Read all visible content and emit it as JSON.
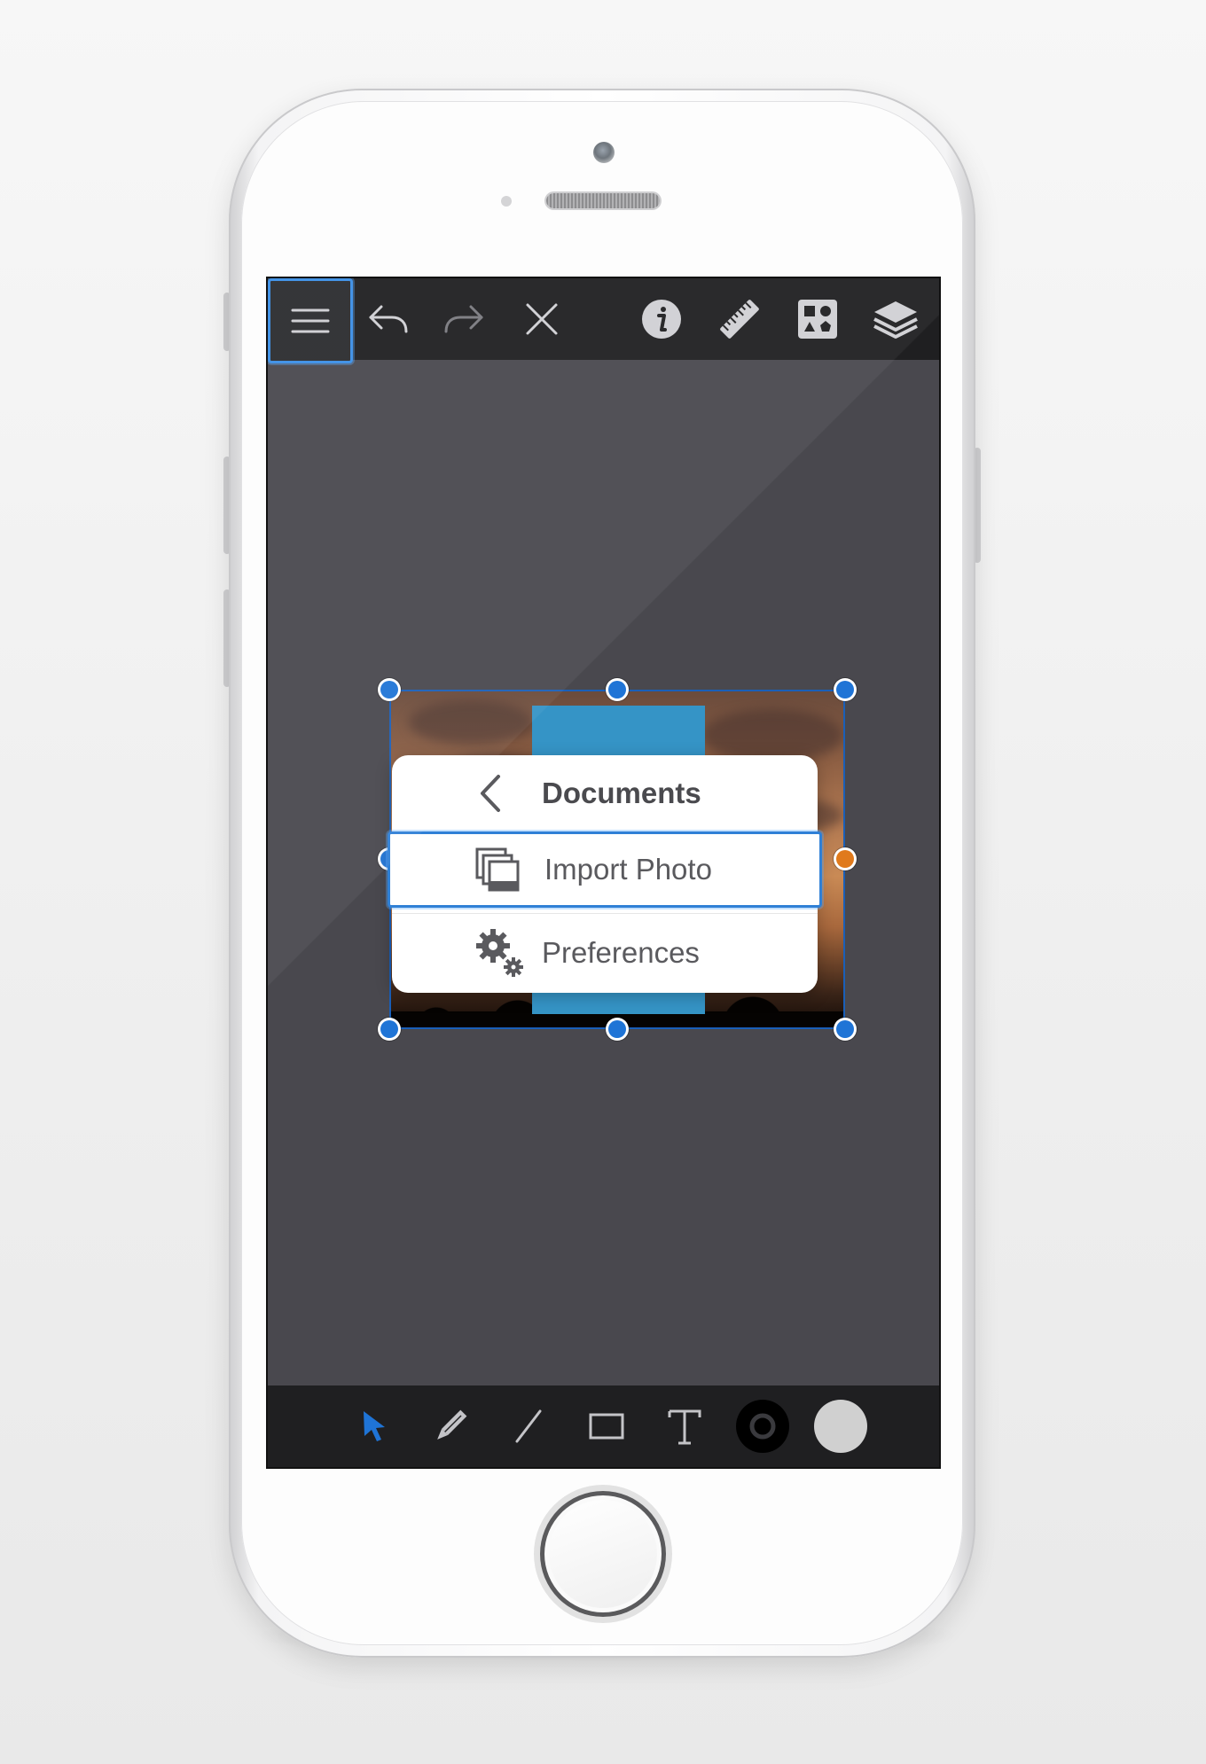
{
  "toolbar": {
    "buttons": [
      {
        "name": "menu-icon",
        "selected": true
      },
      {
        "name": "undo-icon"
      },
      {
        "name": "redo-icon",
        "disabled": true
      },
      {
        "name": "close-icon"
      },
      {
        "name": "info-icon"
      },
      {
        "name": "ruler-icon"
      },
      {
        "name": "shapes-icon"
      },
      {
        "name": "layers-icon"
      }
    ]
  },
  "popup_menu": {
    "header_label": "Documents",
    "items": [
      {
        "label": "Import Photo",
        "icon": "photos-icon",
        "selected": true
      },
      {
        "label": "Preferences",
        "icon": "gears-icon",
        "selected": false
      }
    ]
  },
  "bottom_toolbar": {
    "tools": [
      {
        "name": "select-arrow-icon",
        "active": true
      },
      {
        "name": "pencil-icon"
      },
      {
        "name": "line-icon"
      },
      {
        "name": "rectangle-icon"
      },
      {
        "name": "text-icon"
      },
      {
        "name": "stroke-color-swatch",
        "color": "#000000"
      },
      {
        "name": "fill-color-swatch",
        "color": "#d0d0d0"
      }
    ]
  },
  "colors": {
    "accent": "#1f74d6",
    "rotate_handle": "#e07a1c",
    "canvas_bg": "#49484e",
    "toolbar_bg": "#1f1f21",
    "blue_shape": "#3594c6"
  }
}
